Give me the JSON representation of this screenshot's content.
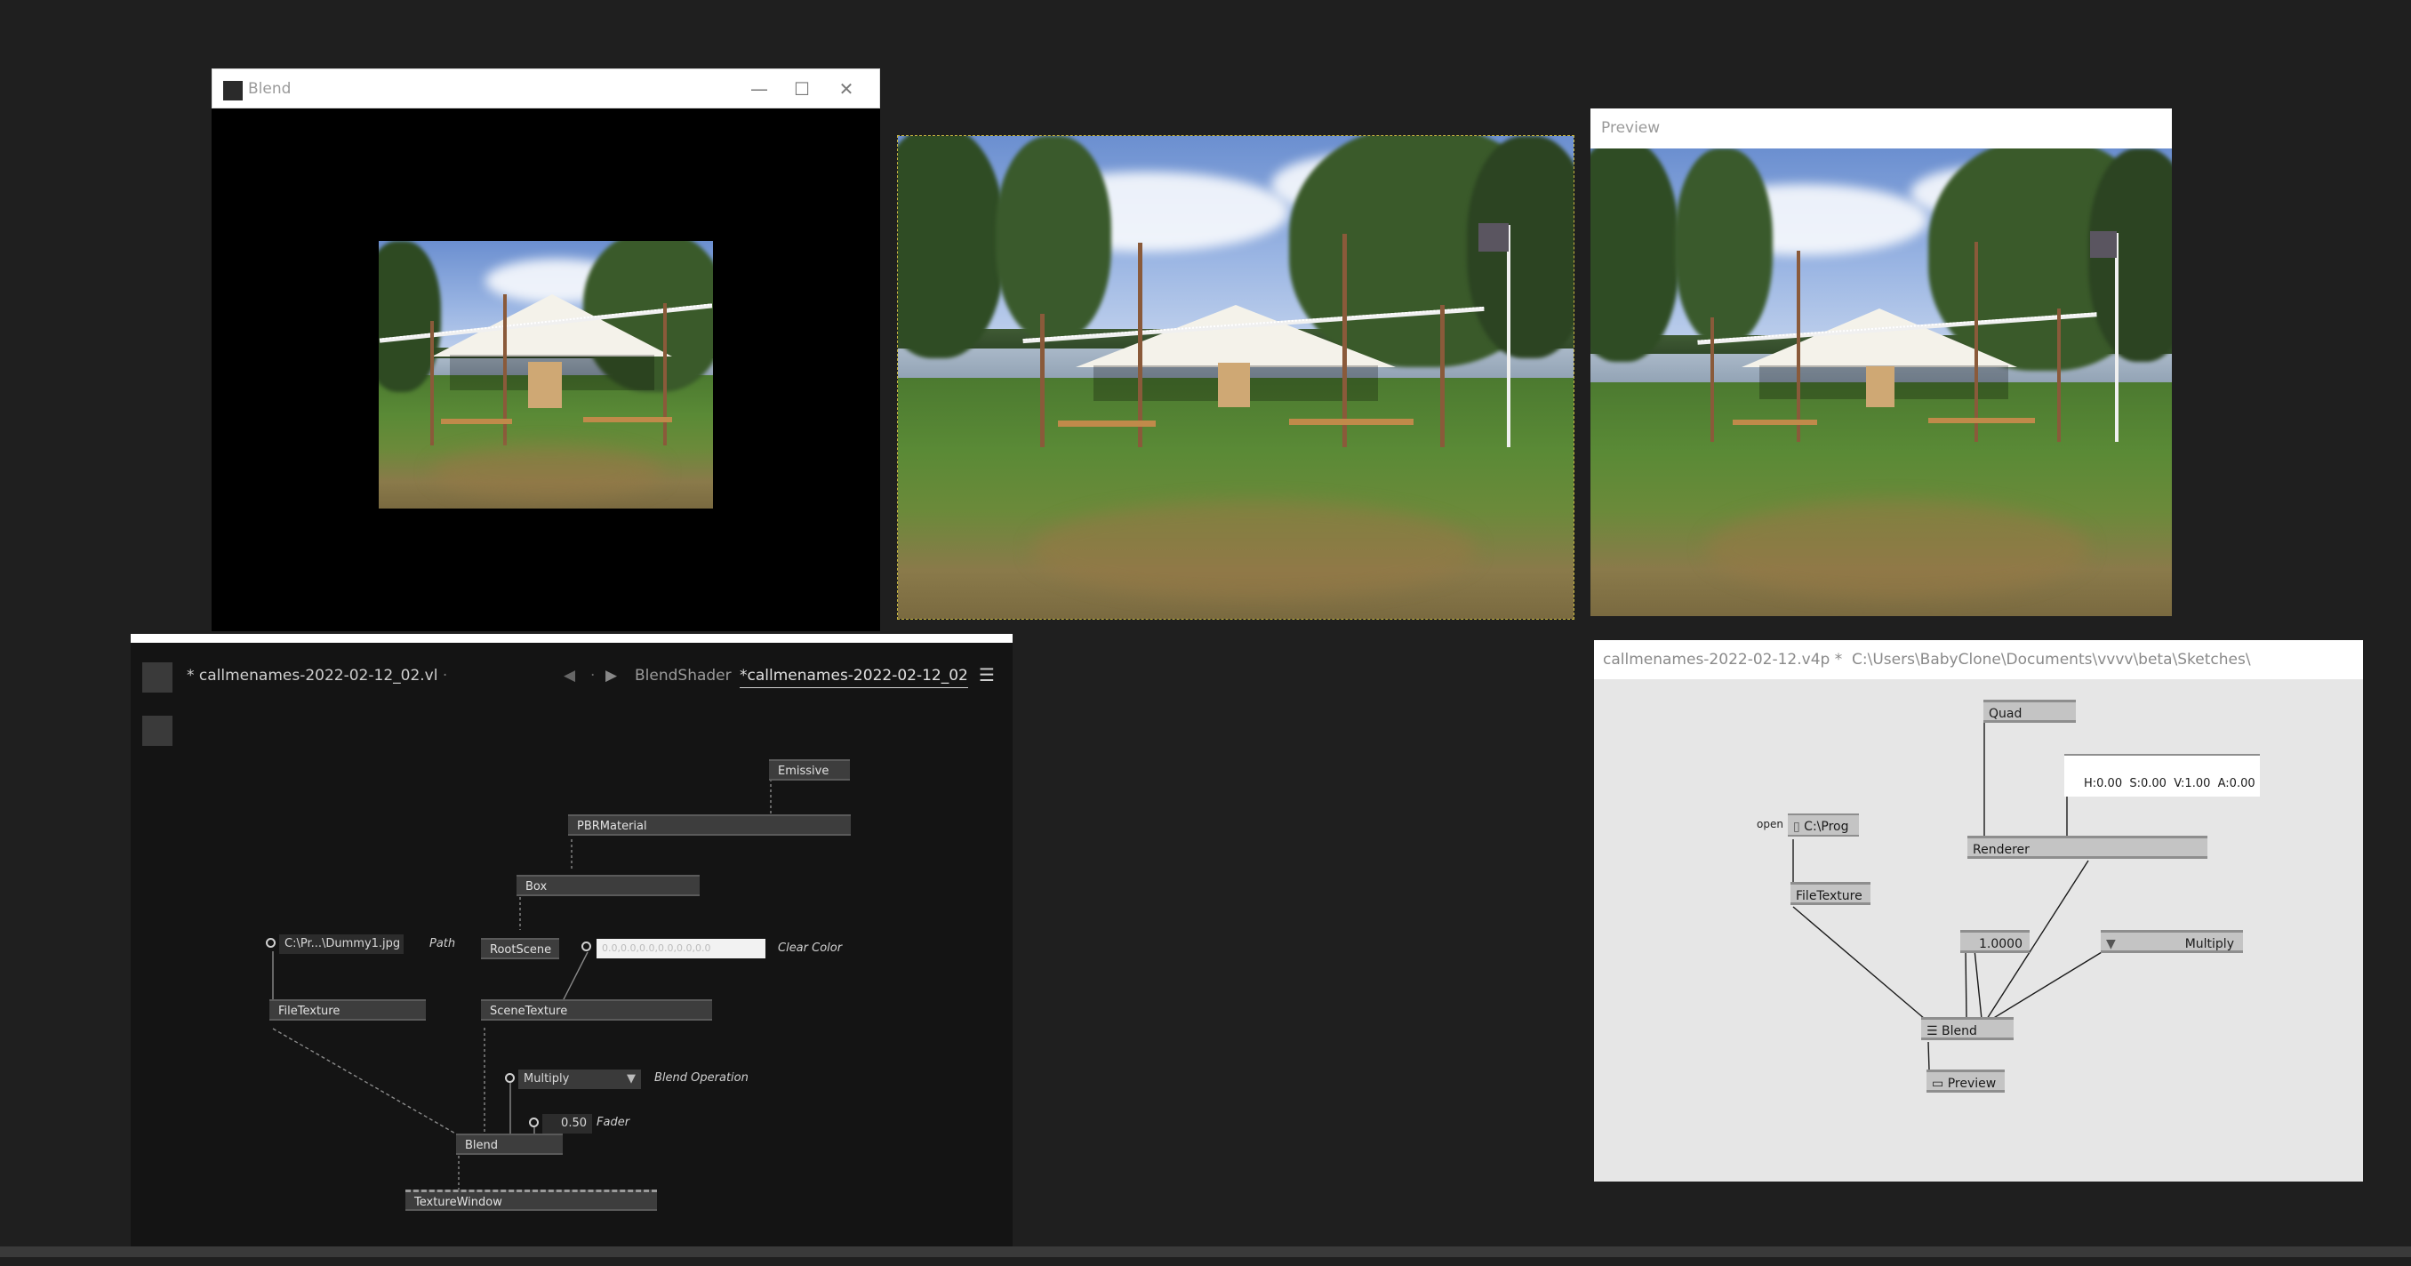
{
  "blend_window": {
    "title": "Blend",
    "controls": {
      "minimize": "—",
      "maximize": "☐",
      "close": "✕"
    }
  },
  "preview_window": {
    "title": "Preview"
  },
  "gamma_editor": {
    "document_name": "* callmenames-2022-02-12_02.vl",
    "doc_name_suffix": "·",
    "nav_back": "◀",
    "nav_sep": "·",
    "nav_forward": "▶",
    "tabs": [
      {
        "label": "BlendShader",
        "active": false
      },
      {
        "label": "*callmenames-2022-02-12_02",
        "active": true
      }
    ],
    "menu_icon": "☰",
    "nodes": {
      "emissive": "Emissive",
      "pbr_material": "PBRMaterial",
      "box": "Box",
      "root_scene": "RootScene",
      "file_texture": "FileTexture",
      "scene_texture": "SceneTexture",
      "blend": "Blend",
      "texture_window": "TextureWindow"
    },
    "pads": {
      "path_value": "C:\\Pr...\\Dummy1.jpg",
      "clear_color_value": "0.0,0.0,0.0,0.0,0.0,0.0",
      "blend_operation_value": "Multiply",
      "fader_value": "0.50"
    },
    "pad_labels": {
      "path": "Path",
      "clear_color": "Clear Color",
      "blend_operation": "Blend Operation",
      "fader": "Fader"
    }
  },
  "beta_editor": {
    "title": "callmenames-2022-02-12.v4p *  C:\\Users\\BabyClone\\Documents\\vvvv\\beta\\Sketches\\",
    "nodes": {
      "quad": "Quad",
      "renderer": "Renderer",
      "file_texture": "FileTexture",
      "blend": "Blend",
      "preview": "Preview"
    },
    "open_label": "open",
    "path_value": "C:\\Prog",
    "color_value": "H:0.00  S:0.00  V:1.00  A:0.00",
    "fader_value": "1.0000",
    "blend_mode_value": "Multiply"
  }
}
